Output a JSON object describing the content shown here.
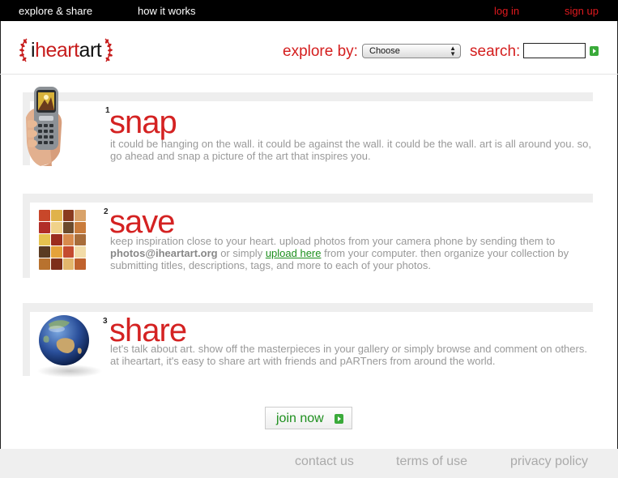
{
  "topnav": {
    "explore_share": "explore & share",
    "how_it_works": "how it works",
    "log_in": "log in",
    "sign_up": "sign up"
  },
  "header": {
    "logo_prefix": "i",
    "logo_accent": "heart",
    "logo_suffix": "art",
    "explore_label": "explore by:",
    "explore_selected": "Choose",
    "search_label": "search:",
    "search_value": ""
  },
  "steps": [
    {
      "number": "1",
      "title": "snap",
      "description": "it could be hanging on the wall. it could be against the wall. it could be the wall. art is all around you. so, go ahead and snap a picture of the art that inspires you."
    },
    {
      "number": "2",
      "title": "save",
      "desc_part1": "keep inspiration close to your heart. upload photos from your camera phone by sending them to ",
      "desc_email": "photos@iheartart.org",
      "desc_part2": " or simply ",
      "desc_link": "upload here",
      "desc_part3": " from your computer. then organize your collection by submitting titles, descriptions, tags, and more to each of your photos."
    },
    {
      "number": "3",
      "title": "share",
      "description": "let's talk about art. show off the masterpieces in your gallery or simply browse and comment on others. at iheartart, it's easy to share art with friends and pARTners from around the world."
    }
  ],
  "join_label": "join now",
  "footer": {
    "contact": "contact us",
    "terms": "terms of use",
    "privacy": "privacy policy"
  },
  "colors": {
    "brand_red": "#d42222",
    "link_green": "#1d8f1d",
    "go_green": "#3aaa3a"
  }
}
